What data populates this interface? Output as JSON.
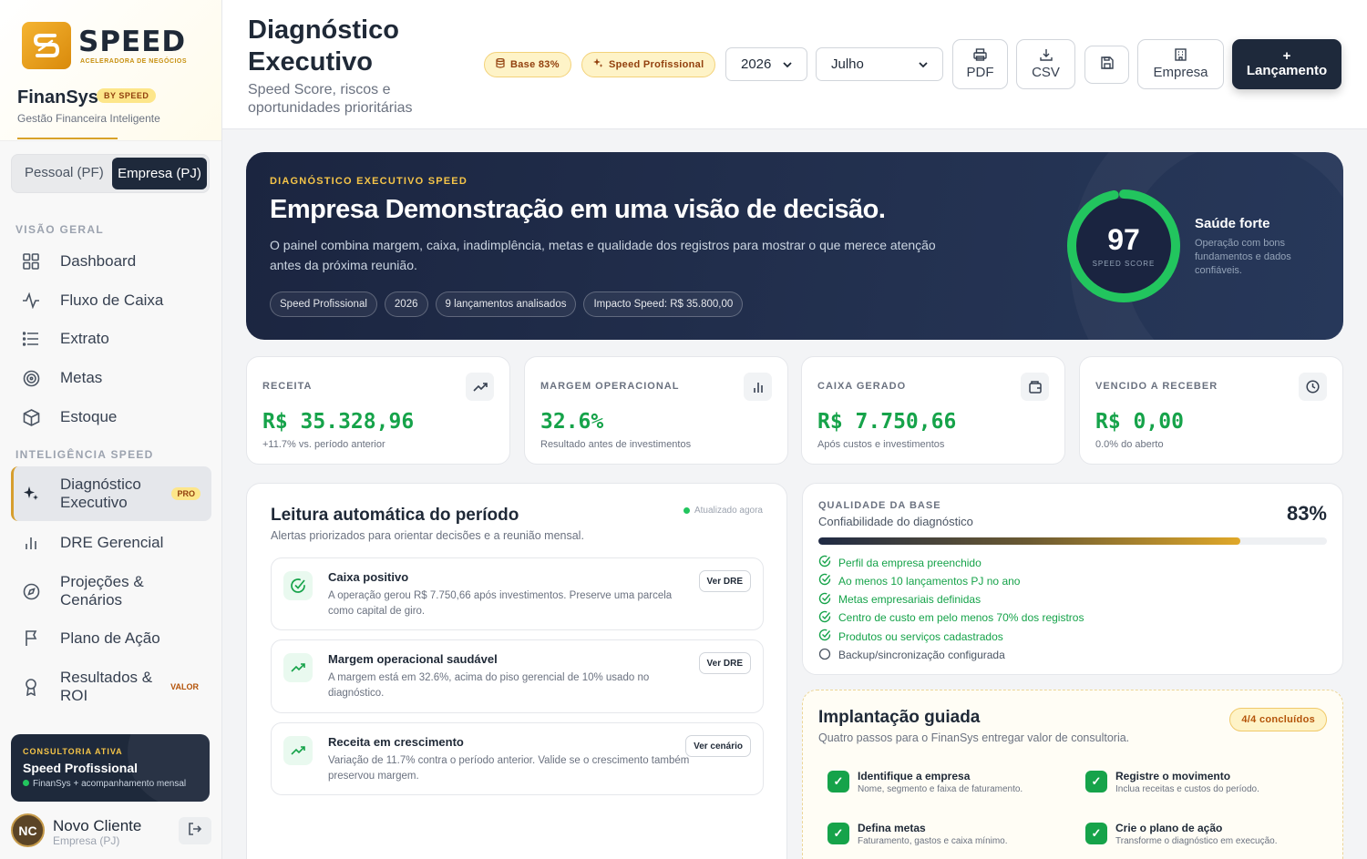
{
  "brand": {
    "logo_text": "SPEED",
    "logo_sub": "ACELERADORA DE NEGÓCIOS",
    "app_name": "FinanSys",
    "by_badge": "BY SPEED",
    "tagline": "Gestão Financeira Inteligente"
  },
  "segment": {
    "pf": "Pessoal (PF)",
    "pj": "Empresa (PJ)",
    "selected": "pj"
  },
  "sidebar": {
    "section_overview": "VISÃO GERAL",
    "overview_items": [
      {
        "label": "Dashboard",
        "icon": "grid-icon"
      },
      {
        "label": "Fluxo de Caixa",
        "icon": "pulse-icon"
      },
      {
        "label": "Extrato",
        "icon": "list-icon"
      },
      {
        "label": "Metas",
        "icon": "target-icon"
      },
      {
        "label": "Estoque",
        "icon": "box-icon"
      }
    ],
    "section_intel": "INTELIGÊNCIA SPEED",
    "intel_items": [
      {
        "label": "Diagnóstico Executivo",
        "icon": "sparkles-icon",
        "badge": "PRO",
        "active": true
      },
      {
        "label": "DRE Gerencial",
        "icon": "bar-chart-icon"
      },
      {
        "label": "Projeções & Cenários",
        "icon": "compass-icon"
      },
      {
        "label": "Plano de Ação",
        "icon": "flag-icon"
      },
      {
        "label": "Resultados & ROI",
        "icon": "award-icon",
        "badge": "VALOR"
      }
    ]
  },
  "consulting": {
    "label": "CONSULTORIA ATIVA",
    "plan": "Speed Profissional",
    "detail": "FinanSys + acompanhamento mensal"
  },
  "user": {
    "initials": "NC",
    "name": "Novo Cliente",
    "role": "Empresa (PJ)"
  },
  "header": {
    "title": "Diagnóstico Executivo",
    "subtitle": "Speed Score, riscos e oportunidades prioritárias",
    "pill_base": "Base 83%",
    "pill_plan": "Speed Profissional",
    "year": "2026",
    "month": "Julho",
    "btn_pdf": "PDF",
    "btn_csv": "CSV",
    "btn_empresa": "Empresa",
    "btn_lancamento_plus": "+",
    "btn_lancamento": "Lançamento"
  },
  "hero": {
    "tag": "DIAGNÓSTICO EXECUTIVO SPEED",
    "title": "Empresa Demonstração em uma visão de decisão.",
    "description": "O painel combina margem, caixa, inadimplência, metas e qualidade dos registros para mostrar o que merece atenção antes da próxima reunião.",
    "chips": [
      "Speed Profissional",
      "2026",
      "9 lançamentos analisados",
      "Impacto Speed: R$ 35.800,00"
    ],
    "score": "97",
    "score_value": 97,
    "score_label": "SPEED SCORE",
    "health_title": "Saúde forte",
    "health_desc": "Operação com bons fundamentos e dados confiáveis."
  },
  "kpis": [
    {
      "label": "RECEITA",
      "value": "R$ 35.328,96",
      "sub": "+11.7% vs. período anterior",
      "icon": "trending-up-icon"
    },
    {
      "label": "MARGEM OPERACIONAL",
      "value": "32.6%",
      "sub": "Resultado antes de investimentos",
      "icon": "bar-chart-icon"
    },
    {
      "label": "CAIXA GERADO",
      "value": "R$ 7.750,66",
      "sub": "Após custos e investimentos",
      "icon": "wallet-icon"
    },
    {
      "label": "VENCIDO A RECEBER",
      "value": "R$ 0,00",
      "sub": "0.0% do aberto",
      "icon": "clock-icon"
    }
  ],
  "reading": {
    "title": "Leitura automática do período",
    "subtitle": "Alertas priorizados para orientar decisões e a reunião mensal.",
    "updated": "Atualizado agora",
    "alerts": [
      {
        "title": "Caixa positivo",
        "desc": "A operação gerou R$ 7.750,66 após investimentos. Preserve uma parcela como capital de giro.",
        "action": "Ver DRE",
        "icon": "check-circle-icon"
      },
      {
        "title": "Margem operacional saudável",
        "desc": "A margem está em 32.6%, acima do piso gerencial de 10% usado no diagnóstico.",
        "action": "Ver DRE",
        "icon": "trending-up-icon"
      },
      {
        "title": "Receita em crescimento",
        "desc": "Variação de 11.7% contra o período anterior. Valide se o crescimento também preservou margem.",
        "action": "Ver cenário",
        "icon": "trending-up-icon"
      }
    ]
  },
  "quality": {
    "label": "QUALIDADE DA BASE",
    "subtitle": "Confiabilidade do diagnóstico",
    "percent": "83%",
    "fill_fraction": 0.83,
    "items": [
      {
        "text": "Perfil da empresa preenchido",
        "done": true
      },
      {
        "text": "Ao menos 10 lançamentos PJ no ano",
        "done": true
      },
      {
        "text": "Metas empresariais definidas",
        "done": true
      },
      {
        "text": "Centro de custo em pelo menos 70% dos registros",
        "done": true
      },
      {
        "text": "Produtos ou serviços cadastrados",
        "done": true
      },
      {
        "text": "Backup/sincronização configurada",
        "done": false
      }
    ],
    "done_color": "#16a34a"
  },
  "implantation": {
    "title": "Implantação guiada",
    "subtitle": "Quatro passos para o FinanSys entregar valor de consultoria.",
    "badge": "4/4 concluídos",
    "steps": [
      {
        "title": "Identifique a empresa",
        "desc": "Nome, segmento e faixa de faturamento."
      },
      {
        "title": "Registre o movimento",
        "desc": "Inclua receitas e custos do período."
      },
      {
        "title": "Defina metas",
        "desc": "Faturamento, gastos e caixa mínimo."
      },
      {
        "title": "Crie o plano de ação",
        "desc": "Transforme o diagnóstico em execução."
      }
    ]
  },
  "colors": {
    "accent": "#d69e2e",
    "navy": "#1e293b",
    "success": "#16a34a",
    "score_ring": "#22c55e"
  }
}
